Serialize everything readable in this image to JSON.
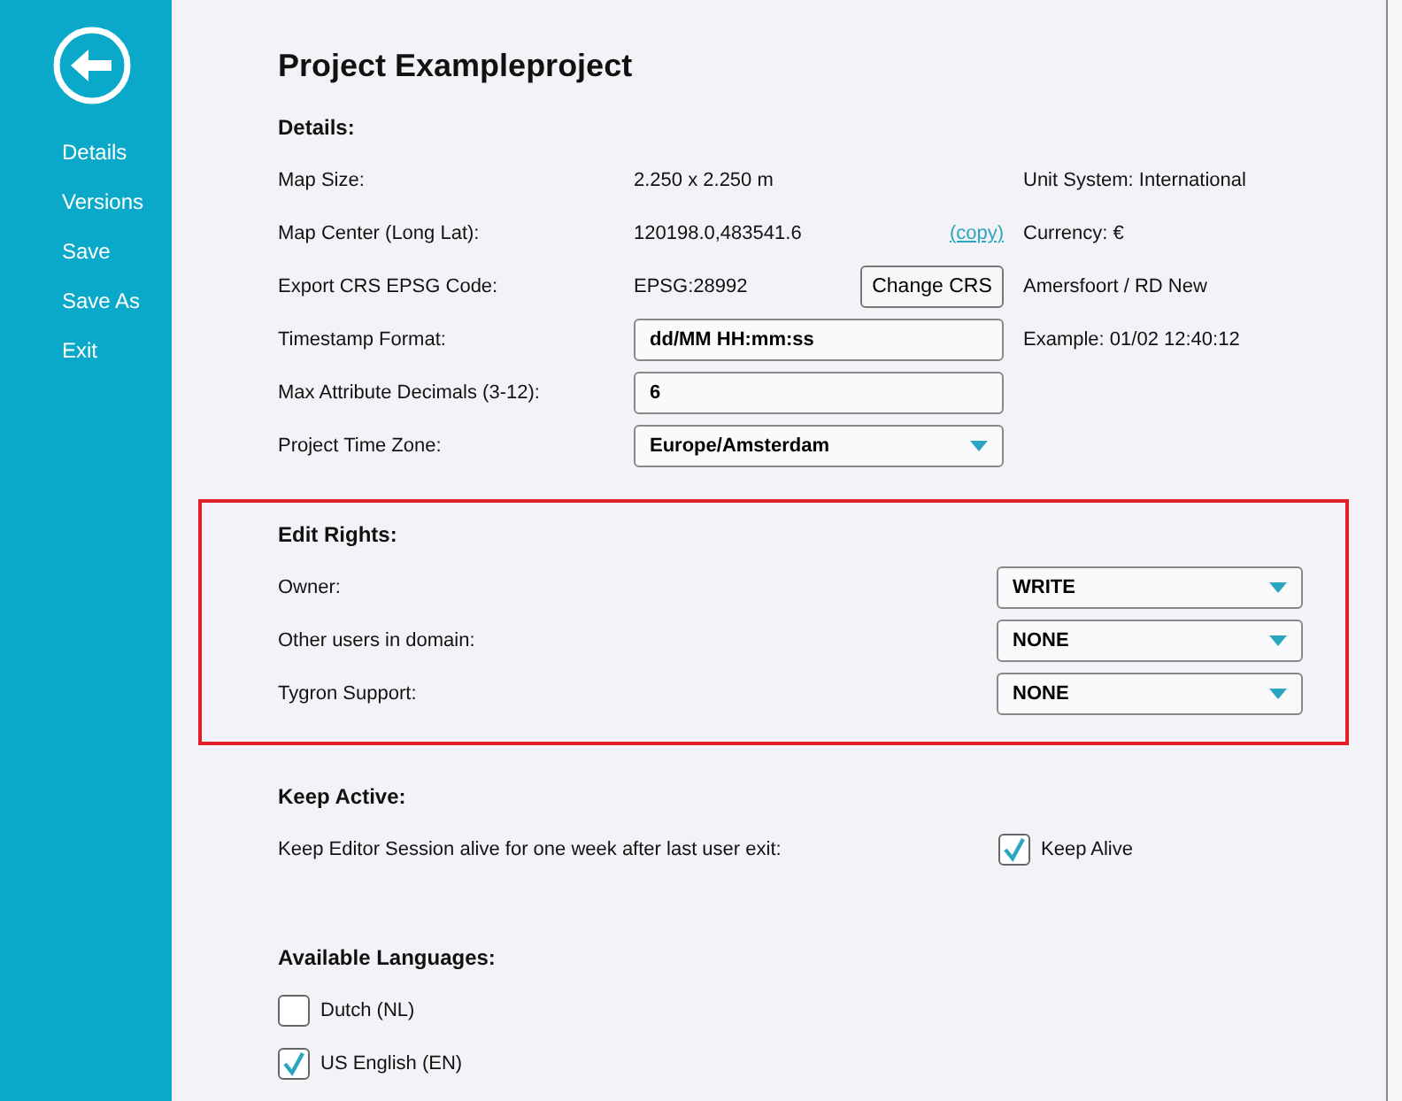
{
  "sidebar": {
    "items": [
      {
        "label": "Details"
      },
      {
        "label": "Versions"
      },
      {
        "label": "Save"
      },
      {
        "label": "Save As"
      },
      {
        "label": "Exit"
      }
    ]
  },
  "title": "Project Exampleproject",
  "details": {
    "heading": "Details:",
    "rows": [
      {
        "kind": "text",
        "label": "Map Size:",
        "value": "2.250 x 2.250 m",
        "note": "Unit System: International"
      },
      {
        "kind": "link",
        "label": "Map Center (Long Lat):",
        "value": "120198.0,483541.6",
        "link": "(copy)",
        "note": "Currency: €"
      },
      {
        "kind": "button",
        "label": "Export CRS EPSG Code:",
        "value": "EPSG:28992",
        "button": "Change CRS",
        "note": "Amersfoort / RD New"
      },
      {
        "kind": "input",
        "label": "Timestamp Format:",
        "value": "dd/MM HH:mm:ss",
        "note": "Example: 01/02 12:40:12"
      },
      {
        "kind": "input",
        "label": "Max Attribute Decimals (3-12):",
        "value": "6"
      },
      {
        "kind": "dropdown",
        "label": "Project Time Zone:",
        "value": "Europe/Amsterdam"
      }
    ]
  },
  "edit_rights": {
    "heading": "Edit Rights:",
    "rows": [
      {
        "label": "Owner:",
        "value": "WRITE"
      },
      {
        "label": "Other users in domain:",
        "value": "NONE"
      },
      {
        "label": "Tygron Support:",
        "value": "NONE"
      }
    ]
  },
  "keep_active": {
    "heading": "Keep Active:",
    "description": "Keep Editor Session alive for one week after last user exit:",
    "checkbox": {
      "label": "Keep Alive",
      "checked": true
    }
  },
  "languages": {
    "heading": "Available Languages:",
    "items": [
      {
        "label": "Dutch (NL)",
        "checked": false
      },
      {
        "label": "US English (EN)",
        "checked": true
      }
    ]
  }
}
